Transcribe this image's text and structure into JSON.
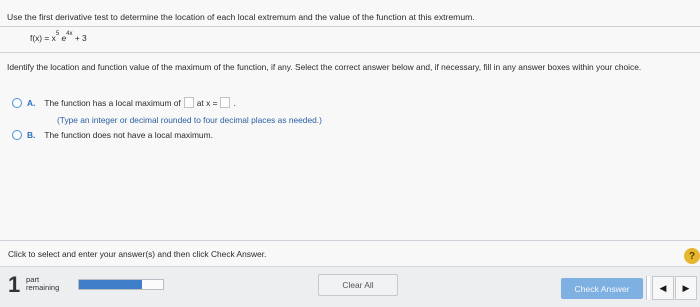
{
  "question": {
    "instruction": "Use the first derivative test to determine the location of each local extremum and the value of the function at this extremum.",
    "function": {
      "lhs": "f(x) = x",
      "exp1": "5",
      "base2": "e",
      "exp2": "4x",
      "tail": "+ 3"
    },
    "prompt": "Identify the location and function value of the maximum of the function, if any. Select the correct answer below and, if necessary, fill in any answer boxes within your choice."
  },
  "options": [
    {
      "letter": "A.",
      "text_before": "The function has a local maximum of",
      "text_middle": "at x =",
      "text_after": ".",
      "hint": "(Type an integer or decimal rounded to four decimal places as needed.)"
    },
    {
      "letter": "B.",
      "text": "The function does not have a local maximum."
    }
  ],
  "footer": {
    "message": "Click to select and enter your answer(s) and then click Check Answer.",
    "help_label": "?"
  },
  "bottom_bar": {
    "part_number": "1",
    "part_line1": "part",
    "part_line2": "remaining",
    "progress_fraction": 0.75,
    "clear_all_label": "Clear All",
    "check_answer_label": "Check Answer",
    "prev_icon": "◀",
    "next_icon": "▶"
  },
  "colors": {
    "accent": "#3f7fca",
    "check_button": "#7fb0e2",
    "help": "#e8b52e"
  }
}
